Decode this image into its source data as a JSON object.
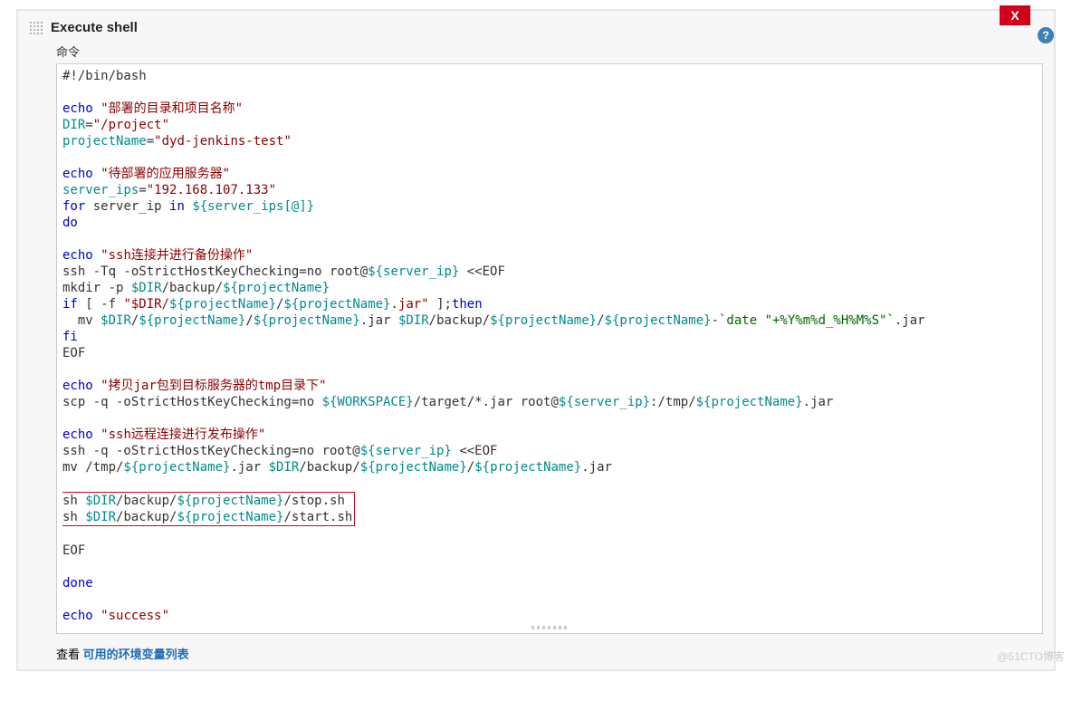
{
  "close_label": "X",
  "help_label": "?",
  "section_title": "Execute shell",
  "field_label": "命令",
  "code": {
    "l1": "#!/bin/bash",
    "l2a": "echo",
    "l2b": "\"部署的目录和项目名称\"",
    "l3a": "DIR",
    "l3b": "=",
    "l3c": "\"/project\"",
    "l4a": "projectName",
    "l4b": "=",
    "l4c": "\"dyd-jenkins-test\"",
    "l5a": "echo",
    "l5b": "\"待部署的应用服务器\"",
    "l6a": "server_ips",
    "l6b": "=",
    "l6c": "\"192.168.107.133\"",
    "l7a": "for",
    "l7b": " server_ip ",
    "l7c": "in",
    "l7d": " ",
    "l7e": "${server_ips[@]}",
    "l8a": "do",
    "l9a": "echo",
    "l9b": "\"ssh连接并进行备份操作\"",
    "l10a": "ssh -Tq -oStrictHostKeyChecking=no root@",
    "l10b": "${server_ip}",
    "l10c": " <<EOF",
    "l11a": "mkdir -p ",
    "l11b": "$DIR",
    "l11c": "/backup/",
    "l11d": "${projectName}",
    "l12a": "if",
    "l12b": " [ -f ",
    "l12c": "\"$DIR",
    "l12d": "/",
    "l12e": "${projectName}",
    "l12f": "/",
    "l12g": "${projectName}",
    "l12h": ".jar\"",
    "l12i": " ];",
    "l12j": "then",
    "l13a": "  mv ",
    "l13b": "$DIR",
    "l13c": "/",
    "l13d": "${projectName}",
    "l13e": "/",
    "l13f": "${projectName}",
    "l13g": ".jar ",
    "l13h": "$DIR",
    "l13i": "/backup/",
    "l13j": "${projectName}",
    "l13k": "/",
    "l13l": "${projectName}",
    "l13m": "-",
    "l13n": "`date \"+%Y%m%d_%H%M%S\"`",
    "l13o": ".jar",
    "l14a": "fi",
    "l15a": "EOF",
    "l16a": "echo",
    "l16b": "\"拷贝jar包到目标服务器的tmp目录下\"",
    "l17a": "scp -q -oStrictHostKeyChecking=no ",
    "l17b": "${WORKSPACE}",
    "l17c": "/target/*.jar root@",
    "l17d": "${server_ip}",
    "l17e": ":/tmp/",
    "l17f": "${projectName}",
    "l17g": ".jar",
    "l18a": "echo",
    "l18b": "\"ssh远程连接进行发布操作\"",
    "l19a": "ssh -q -oStrictHostKeyChecking=no root@",
    "l19b": "${server_ip}",
    "l19c": " <<EOF",
    "l20a": "mv /tmp/",
    "l20b": "${projectName}",
    "l20c": ".jar ",
    "l20d": "$DIR",
    "l20e": "/backup/",
    "l20f": "${projectName}",
    "l20g": "/",
    "l20h": "${projectName}",
    "l20i": ".jar",
    "l21a": "sh ",
    "l21b": "$DIR",
    "l21c": "/backup/",
    "l21d": "${projectName}",
    "l21e": "/stop.sh",
    "l22a": "sh ",
    "l22b": "$DIR",
    "l22c": "/backup/",
    "l22d": "${projectName}",
    "l22e": "/start.sh",
    "l23a": "EOF",
    "l24a": "done",
    "l25a": "echo",
    "l25b": "\"success\""
  },
  "bottom_prefix": "查看 ",
  "bottom_link": "可用的环境变量列表",
  "watermark": "@51CTO博客"
}
